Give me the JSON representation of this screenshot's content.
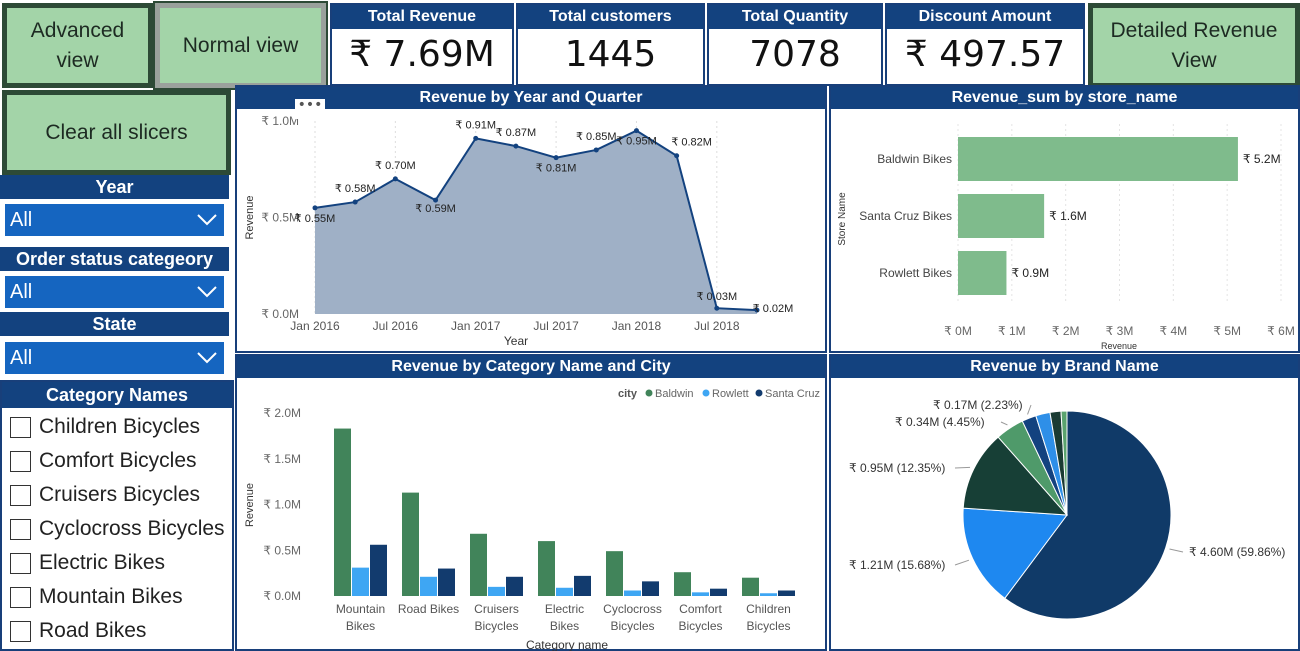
{
  "nav": {
    "advanced_view": "Advanced view",
    "normal_view": "Normal view",
    "clear_slicers": "Clear all slicers",
    "detailed_revenue_view": "Detailed Revenue View"
  },
  "kpis": [
    {
      "title": "Total Revenue",
      "value": "₹ 7.69M"
    },
    {
      "title": "Total customers",
      "value": "1445"
    },
    {
      "title": "Total Quantity",
      "value": "7078"
    },
    {
      "title": "Discount Amount",
      "value": "₹ 497.57"
    }
  ],
  "slicers": {
    "year": {
      "title": "Year",
      "value": "All"
    },
    "order_status": {
      "title": "Order status categeory",
      "value": "All"
    },
    "state": {
      "title": "State",
      "value": "All"
    }
  },
  "category_slicer": {
    "title": "Category Names",
    "items": [
      "Children Bicycles",
      "Comfort Bicycles",
      "Cruisers Bicycles",
      "Cyclocross Bicycles",
      "Electric Bikes",
      "Mountain Bikes",
      "Road Bikes"
    ]
  },
  "visual_menu_icon": "ellipsis-icon",
  "chart_data": [
    {
      "type": "area",
      "title": "Revenue by Year and Quarter",
      "xlabel": "Year",
      "ylabel": "Revenue",
      "x_ticks": [
        "Jan 2016",
        "Jul 2016",
        "Jan 2017",
        "Jul 2017",
        "Jan 2018",
        "Jul 2018"
      ],
      "y_ticks": [
        "₹ 0.0M",
        "₹ 0.5M",
        "₹ 1.0M"
      ],
      "ylim": [
        0,
        1.0
      ],
      "x": [
        "2016 Q1",
        "2016 Q2",
        "2016 Q3",
        "2016 Q4",
        "2017 Q1",
        "2017 Q2",
        "2017 Q3",
        "2017 Q4",
        "2018 Q1",
        "2018 Q2",
        "2018 Q3",
        "2018 Q4"
      ],
      "values": [
        0.55,
        0.58,
        0.7,
        0.59,
        0.91,
        0.87,
        0.81,
        0.85,
        0.95,
        0.82,
        0.03,
        0.02
      ],
      "labels": [
        "₹ 0.55M",
        "₹ 0.58M",
        "₹ 0.70M",
        "₹ 0.59M",
        "₹ 0.91M",
        "₹ 0.87M",
        "₹ 0.81M",
        "₹ 0.85M",
        "₹ 0.95M",
        "₹ 0.82M",
        "₹ 0.03M",
        "₹ 0.02M"
      ],
      "color": "#13427f",
      "fill": "#9fb0c6"
    },
    {
      "type": "bar",
      "orientation": "horizontal",
      "title": "Revenue_sum by store_name",
      "xlabel": "Revenue",
      "ylabel": "Store Name",
      "categories": [
        "Baldwin Bikes",
        "Santa Cruz Bikes",
        "Rowlett Bikes"
      ],
      "values": [
        5.2,
        1.6,
        0.9
      ],
      "labels": [
        "₹ 5.2M",
        "₹ 1.6M",
        "₹ 0.9M"
      ],
      "x_ticks": [
        "₹ 0M",
        "₹ 1M",
        "₹ 2M",
        "₹ 3M",
        "₹ 4M",
        "₹ 5M",
        "₹ 6M"
      ],
      "xlim": [
        0,
        6
      ],
      "color": "#7fbb8c"
    },
    {
      "type": "bar",
      "title": "Revenue by Category Name and City",
      "xlabel": "Category name",
      "ylabel": "Revenue",
      "categories": [
        "Mountain Bikes",
        "Road Bikes",
        "Cruisers Bicycles",
        "Electric Bikes",
        "Cyclocross Bicycles",
        "Comfort Bicycles",
        "Children Bicycles"
      ],
      "y_ticks": [
        "₹ 0.0M",
        "₹ 0.5M",
        "₹ 1.0M",
        "₹ 1.5M",
        "₹ 2.0M"
      ],
      "ylim": [
        0,
        2.0
      ],
      "legend_title": "city",
      "legend_position": "top-right",
      "series": [
        {
          "name": "Baldwin",
          "color": "#41845a",
          "values": [
            1.83,
            1.13,
            0.68,
            0.6,
            0.49,
            0.26,
            0.2
          ]
        },
        {
          "name": "Rowlett",
          "color": "#3ea6f3",
          "values": [
            0.31,
            0.21,
            0.1,
            0.09,
            0.06,
            0.04,
            0.03
          ]
        },
        {
          "name": "Santa Cruz",
          "color": "#123b6e",
          "values": [
            0.56,
            0.3,
            0.21,
            0.22,
            0.16,
            0.08,
            0.06
          ]
        }
      ]
    },
    {
      "type": "pie",
      "title": "Revenue by Brand Name",
      "slices": [
        {
          "value": 4.6,
          "label": "₹ 4.60M (59.86%)",
          "color": "#103a68"
        },
        {
          "value": 1.21,
          "label": "₹ 1.21M (15.68%)",
          "color": "#1e88f0"
        },
        {
          "value": 0.95,
          "label": "₹ 0.95M (12.35%)",
          "color": "#173f36"
        },
        {
          "value": 0.34,
          "label": "₹ 0.34M (4.45%)",
          "color": "#4f9a6a"
        },
        {
          "value": 0.17,
          "label": "₹ 0.17M (2.23%)",
          "color": "#13427f"
        },
        {
          "value": 0.17,
          "label": "",
          "color": "#2e8fe8"
        },
        {
          "value": 0.13,
          "label": "",
          "color": "#1a3b33"
        },
        {
          "value": 0.07,
          "label": "",
          "color": "#5aa36e"
        }
      ]
    }
  ]
}
